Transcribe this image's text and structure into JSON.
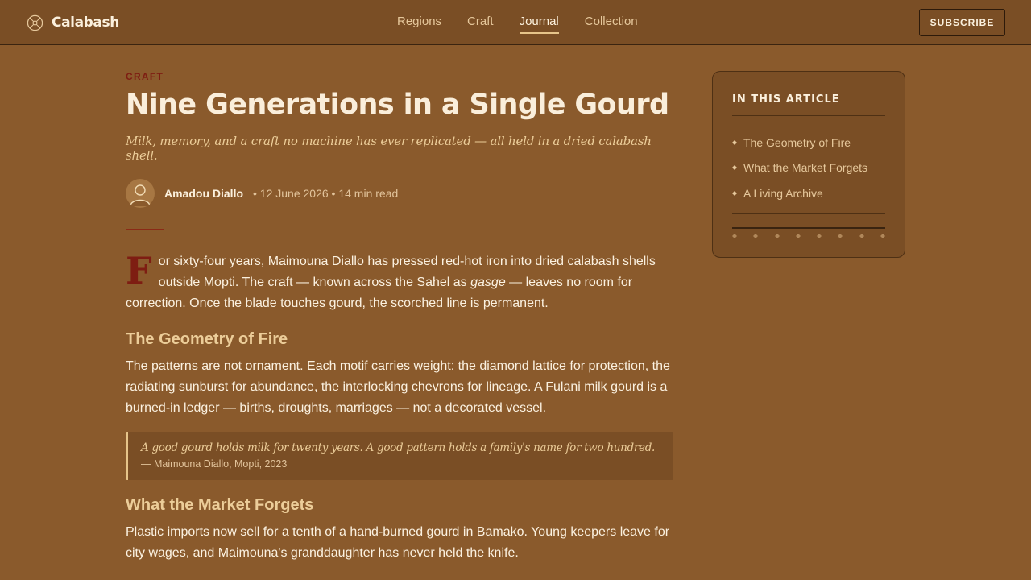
{
  "header": {
    "brand": "Calabash",
    "nav": [
      "Regions",
      "Craft",
      "Journal",
      "Collection"
    ],
    "active_nav": "Journal",
    "subscribe_label": "SUBSCRIBE"
  },
  "article": {
    "eyebrow": "CRAFT",
    "title": "Nine Generations in a Single Gourd",
    "subtitle": "Milk, memory, and a craft no machine has ever replicated — all held in a dried calabash shell.",
    "author": "Amadou Diallo",
    "meta": "• 12 June 2026 • 14 min read",
    "lead_dropcap": "F",
    "lead_before_em": "or sixty-four years, Maimouna Diallo has pressed red-hot iron into dried calabash shells outside Mopti. The craft — known across the Sahel as ",
    "lead_em": "gasge",
    "lead_after_em": " — leaves no room for correction. Once the blade touches gourd, the scorched line is permanent.",
    "section1_heading": "The Geometry of Fire",
    "section1_body": "The patterns are not ornament. Each motif carries weight: the diamond lattice for protection, the radiating sunburst for abundance, the interlocking chevrons for lineage. A Fulani milk gourd is a burned-in ledger — births, droughts, marriages — not a decorated vessel.",
    "quote_text": "A good gourd holds milk for twenty years. A good pattern holds a family's name for two hundred.",
    "quote_cite": "— Maimouna Diallo, Mopti, 2023",
    "section2_heading": "What the Market Forgets",
    "section2_body": "Plastic imports now sell for a tenth of a hand-burned gourd in Bamako. Young keepers leave for city wages, and Maimouna's granddaughter has never held the knife."
  },
  "toc": {
    "heading": "IN THIS ARTICLE",
    "items": [
      "The Geometry of Fire",
      "What the Market Forgets",
      "A Living Archive"
    ]
  },
  "icons": {
    "brand": "calabash-rosette-icon",
    "avatar": "user-avatar-icon",
    "toc_bullet": "diamond-bullet-icon"
  },
  "colors": {
    "page_bg": "#8a5a2c",
    "header_bg": "#7a4e25",
    "accent_red": "#7e1d12",
    "heading_gold": "#eccd99",
    "text_cream": "#fbf1e0"
  }
}
